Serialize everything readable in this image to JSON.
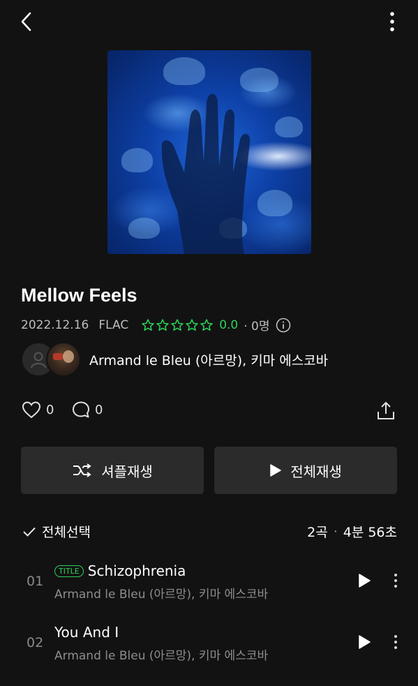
{
  "album": {
    "title": "Mellow Feels",
    "release_date": "2022.12.16",
    "format": "FLAC",
    "rating_value": "0.0",
    "rating_count": "· 0명",
    "stars_filled": 0,
    "stars_total": 5,
    "artists": "Armand le Bleu (아르망), 키마 에스코바"
  },
  "social": {
    "likes": "0",
    "comments": "0"
  },
  "actions": {
    "shuffle_label": "셔플재생",
    "play_all_label": "전체재생"
  },
  "tracklist": {
    "select_all_label": "전체선택",
    "track_count": "2곡",
    "separator": "·",
    "total_duration": "4분 56초",
    "tracks": [
      {
        "number": "01",
        "title": "Schizophrenia",
        "badge": "TITLE",
        "artist": "Armand le Bleu (아르망), 키마 에스코바"
      },
      {
        "number": "02",
        "title": "You And I",
        "badge": "",
        "artist": "Armand le Bleu (아르망), 키마 에스코바"
      }
    ]
  },
  "colors": {
    "background": "#121212",
    "accent_green": "#2fd15a",
    "button_bg": "#2b2b2b"
  },
  "icons": [
    "back-icon",
    "more-vertical-icon",
    "star-outline-icon",
    "info-icon",
    "heart-icon",
    "comment-icon",
    "share-icon",
    "shuffle-icon",
    "play-icon",
    "check-icon"
  ]
}
